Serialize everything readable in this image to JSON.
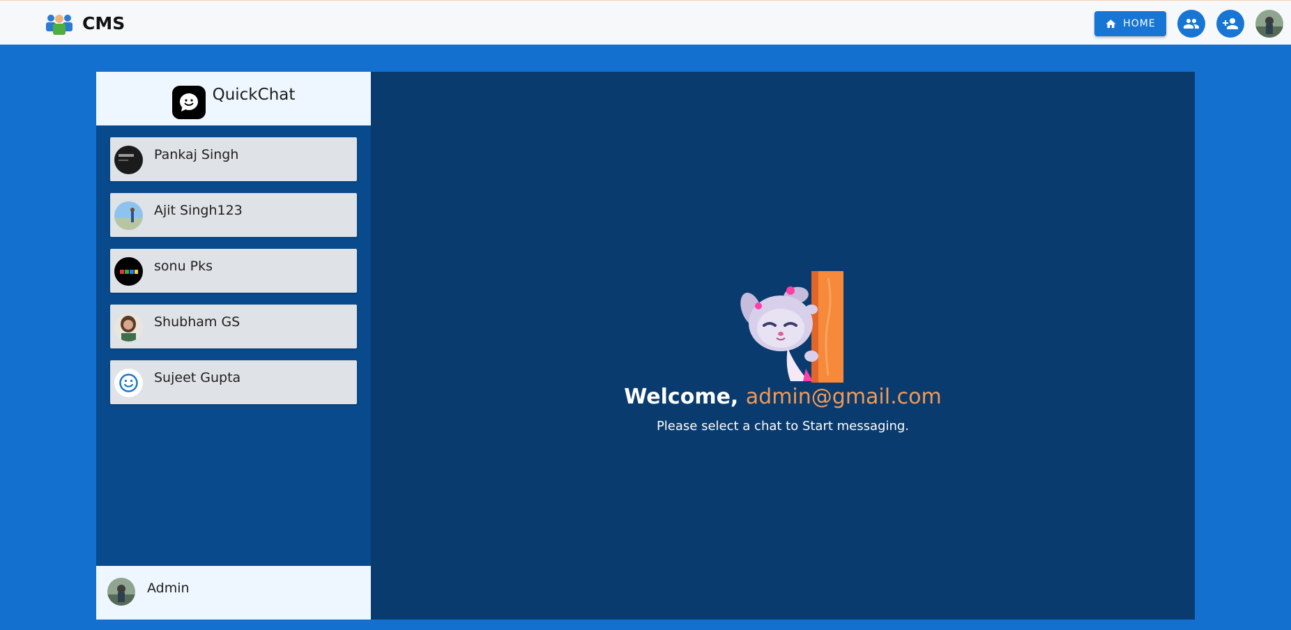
{
  "navbar": {
    "brand": "CMS",
    "home_label": "HOME",
    "icons": [
      "people-icon",
      "person-add-icon"
    ]
  },
  "sidebar": {
    "title": "QuickChat",
    "chats": [
      {
        "name": "Pankaj Singh"
      },
      {
        "name": "Ajit Singh123"
      },
      {
        "name": "sonu Pks"
      },
      {
        "name": "Shubham GS"
      },
      {
        "name": "Sujeet Gupta"
      }
    ],
    "current_user": "Admin"
  },
  "main": {
    "welcome_prefix": "Welcome, ",
    "welcome_email": "admin@gmail.com",
    "subtitle": "Please select a chat to Start messaging."
  },
  "colors": {
    "accent": "#1775d4",
    "page_bg": "#1370cf",
    "sidebar_bg": "#084a8c",
    "main_bg": "#093b6e",
    "email_color": "#f29a57"
  }
}
